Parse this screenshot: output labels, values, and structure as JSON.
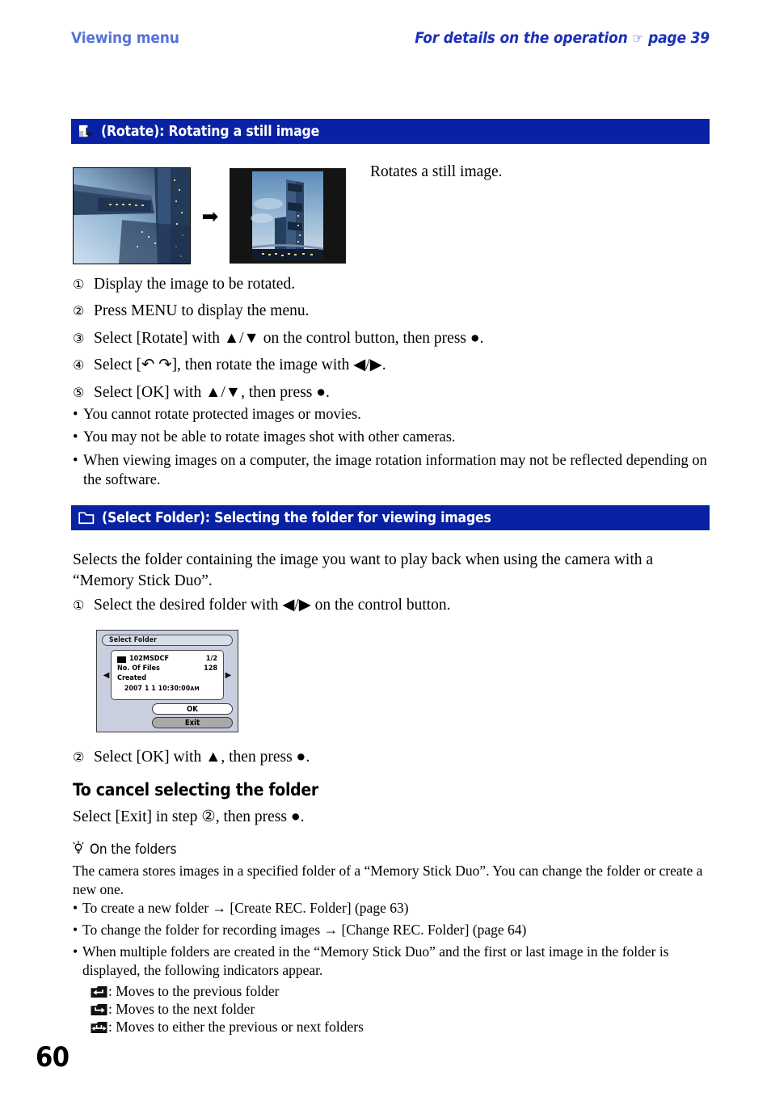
{
  "header": {
    "left_title": "Viewing menu",
    "right_title_pre": "For details on the operation",
    "hand_icon": "☞",
    "right_title_post": "page 39"
  },
  "section_rotate": {
    "banner_icon": "rotate-image-icon",
    "banner_title": "(Rotate): Rotating a still image",
    "photo_before_alt": "skyscraper photo rotated sideways",
    "photo_arrow": "➡",
    "photo_after_alt": "skyscraper photo upright",
    "description": "Rotates a still image.",
    "steps": [
      {
        "num": "①",
        "text": "Display the image to be rotated."
      },
      {
        "num": "②",
        "text": "Press MENU to display the menu."
      },
      {
        "num": "③",
        "text": "Select [Rotate] with ▲/▼ on the control button, then press ●."
      },
      {
        "num": "④",
        "text": "Select [↶ ↷], then rotate the image with ◀/▶."
      },
      {
        "num": "⑤",
        "text": "Select [OK] with ▲/▼, then press ●."
      }
    ],
    "notes": [
      "You cannot rotate protected images or movies.",
      "You may not be able to rotate images shot with other cameras.",
      "When viewing images on a computer, the image rotation information may not be reflected depending on the software."
    ]
  },
  "section_select_folder": {
    "banner_icon": "folder-icon",
    "banner_title": "(Select Folder): Selecting the folder for viewing images",
    "intro": "Selects the folder containing the image you want to play back when using the camera with a “Memory Stick Duo”.",
    "step1": {
      "num": "①",
      "text": "Select the desired folder with ◀/▶ on the control button."
    },
    "step2": {
      "num": "②",
      "text": "Select [OK] with ▲, then press ●."
    },
    "lcd": {
      "title": "Select Folder",
      "left_arrow": "◀",
      "right_arrow": "▶",
      "folder_name": "102MSDCF",
      "folder_index": "1/2",
      "files_label": "No. Of Files",
      "files_value": "128",
      "created_label": "Created",
      "created_date": "2007  1  1  10:30:00",
      "created_ampm": "AM",
      "ok_label": "OK",
      "exit_label": "Exit"
    },
    "cancel_heading": "To cancel selecting the folder",
    "cancel_text": "Select [Exit] in step ②, then press ●.",
    "tip": {
      "icon": "lightbulb-icon",
      "heading": "On the folders",
      "body": "The camera stores images in a specified folder of a “Memory Stick Duo”. You can change the folder or create a new one.",
      "bullets": [
        "To create a new folder → [Create REC. Folder] (page 63)",
        "To change the folder for recording images → [Change REC. Folder] (page 64)",
        "When multiple folders are created in the “Memory Stick Duo” and the first or last image in the folder is displayed, the following indicators appear."
      ],
      "indicators": [
        {
          "icon": "folder-previous-icon",
          "text": ": Moves to the previous folder"
        },
        {
          "icon": "folder-next-icon",
          "text": ": Moves to the next folder"
        },
        {
          "icon": "folder-previous-next-icon",
          "text": ": Moves to either the previous or next folders"
        }
      ]
    }
  },
  "footer": {
    "page_number": "60"
  },
  "colors": {
    "banner_blue": "#0821a5",
    "header_light_blue": "#5873d8",
    "header_dark_blue": "#1c30b8",
    "lcd_background": "#c9cfdf"
  }
}
